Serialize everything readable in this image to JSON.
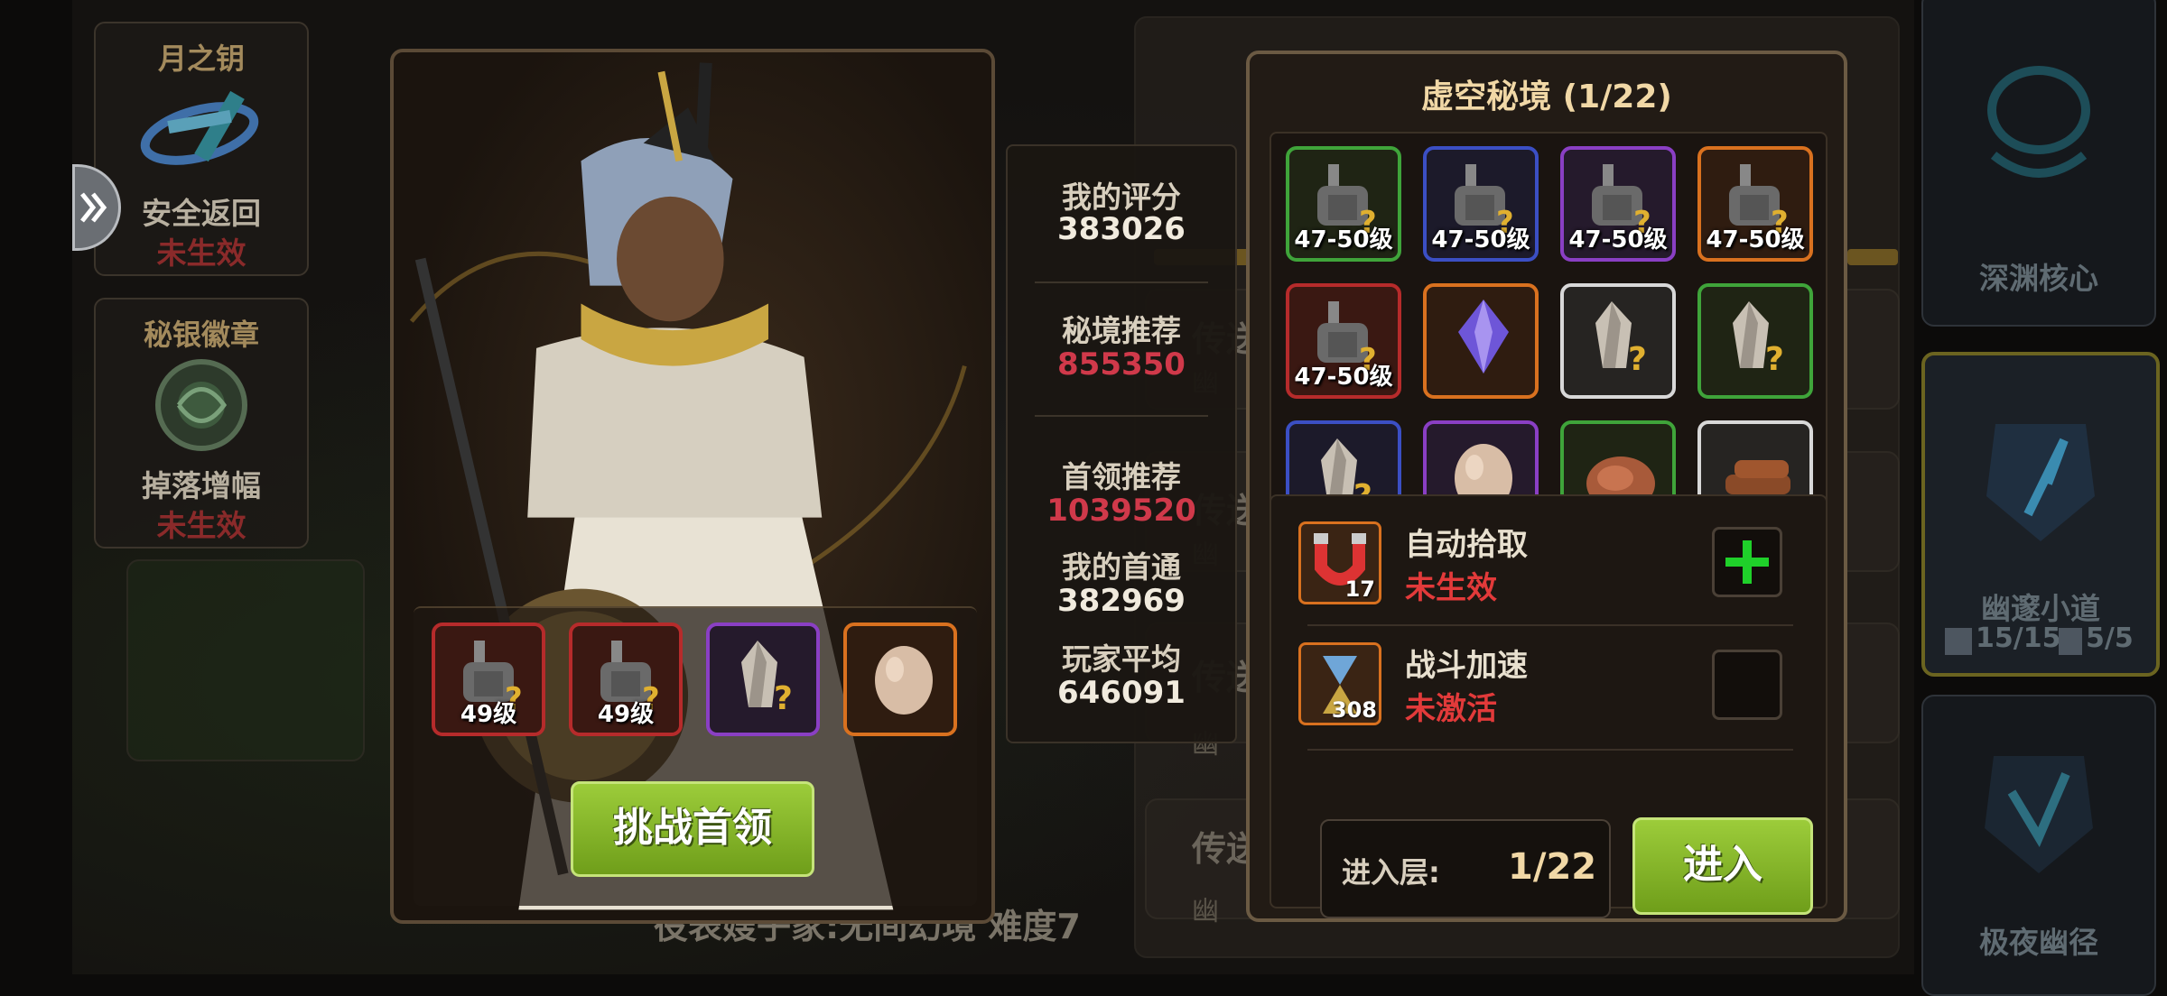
{
  "left_cards": [
    {
      "title": "月之钥",
      "name": "安全返回",
      "status": "未生效",
      "icon": "moon-key-icon"
    },
    {
      "title": "秘银徽章",
      "name": "掉落增幅",
      "status": "未生效",
      "icon": "mithril-badge-icon"
    }
  ],
  "right_cards": [
    {
      "name": "深渊核心"
    },
    {
      "name": "幽邃小道",
      "stat1": "15/15",
      "stat2": "5/5"
    },
    {
      "name": "极夜幽径"
    }
  ],
  "background": {
    "rows": [
      "传送",
      "传送",
      "传送",
      "传送"
    ],
    "subs": [
      "幽",
      "幽",
      "幽",
      "幽"
    ],
    "caption": "役表嫂子家:无间幻境 难度7"
  },
  "boss": {
    "loot": [
      {
        "label": "49级",
        "rarity": "red",
        "icon": "armor-unknown-icon"
      },
      {
        "label": "49级",
        "rarity": "red",
        "icon": "armor-unknown-icon"
      },
      {
        "label": "",
        "rarity": "purple",
        "icon": "crystal-unknown-icon"
      },
      {
        "label": "",
        "rarity": "orange",
        "icon": "egg-icon"
      }
    ],
    "challenge_label": "挑战首领"
  },
  "stats": {
    "my_score_label": "我的评分",
    "my_score": "383026",
    "recommend_label": "秘境推荐",
    "recommend": "855350",
    "boss_recommend_label": "首领推荐",
    "boss_recommend": "1039520",
    "my_first_label": "我的首通",
    "my_first": "382969",
    "player_avg_label": "玩家平均",
    "player_avg": "646091",
    "colors": {
      "normal": "#f1ebde",
      "warn": "#d0394a"
    }
  },
  "dungeon": {
    "title": "虚空秘境 (1/22)",
    "rewards": [
      {
        "label": "47-50级",
        "rarity": "green",
        "icon": "armor-unknown-icon"
      },
      {
        "label": "47-50级",
        "rarity": "blue",
        "icon": "armor-unknown-icon"
      },
      {
        "label": "47-50级",
        "rarity": "purple",
        "icon": "armor-unknown-icon"
      },
      {
        "label": "47-50级",
        "rarity": "orange",
        "icon": "armor-unknown-icon"
      },
      {
        "label": "47-50级",
        "rarity": "red",
        "icon": "armor-unknown-icon"
      },
      {
        "label": "",
        "rarity": "orange",
        "icon": "purple-gem-icon"
      },
      {
        "label": "",
        "rarity": "white",
        "icon": "crystal-unknown-icon"
      },
      {
        "label": "",
        "rarity": "green",
        "icon": "crystal-unknown-icon"
      },
      {
        "label": "",
        "rarity": "blue",
        "icon": "crystal-unknown-icon"
      },
      {
        "label": "",
        "rarity": "purple",
        "icon": "egg-icon"
      },
      {
        "label": "",
        "rarity": "green",
        "icon": "meat-icon"
      },
      {
        "label": "",
        "rarity": "white",
        "icon": "wood-icon"
      }
    ],
    "auto_pick": {
      "title": "自动拾取",
      "state": "未生效",
      "count": "17",
      "icon": "magnet-icon"
    },
    "battle_speed": {
      "title": "战斗加速",
      "state": "未激活",
      "count": "308",
      "icon": "hourglass-icon"
    },
    "floor_label": "进入层:",
    "floor_value": "1/22",
    "enter_label": "进入"
  }
}
